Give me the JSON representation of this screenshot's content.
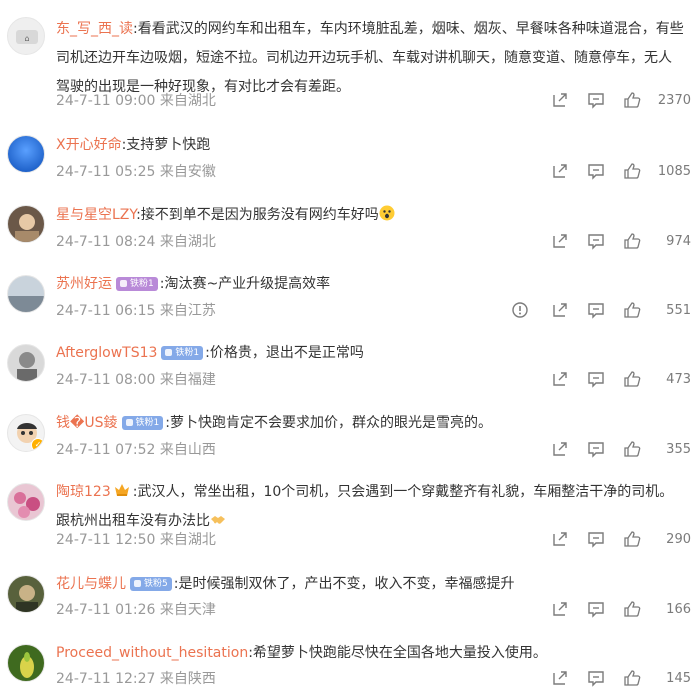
{
  "colors": {
    "username": "#eb7350",
    "meta": "#999999",
    "text": "#333333",
    "icon": "#7b7b7b"
  },
  "comments": [
    {
      "user": "东_写_西_读",
      "text": ":看看武汉的网约车和出租车，车内环境脏乱差，烟味、烟灰、早餐味各种味道混合，有些司机还边开车边吸烟，短途不拉。司机边开边玩手机、车载对讲机聊天，随意变道、随意停车，无人驾驶的出现是一种好现象，有对比才会有差距。",
      "time": "24-7-11 09:00",
      "location": "来自湖北",
      "likes": "2370"
    },
    {
      "user": "X开心好命",
      "text": ":支持萝卜快跑",
      "time": "24-7-11 05:25",
      "location": "来自安徽",
      "likes": "1085"
    },
    {
      "user": "星与星空LZY",
      "text": ":接不到单不是因为服务没有网约车好吗",
      "time": "24-7-11 08:24",
      "location": "来自湖北",
      "likes": "974"
    },
    {
      "user": "苏州好运",
      "badge": "铁粉1",
      "text": ":淘汰赛~产业升级提高效率",
      "time": "24-7-11 06:15",
      "location": "来自江苏",
      "likes": "551"
    },
    {
      "user": "AfterglowTS13",
      "badge": "铁粉1",
      "text": ":价格贵，退出不是正常吗",
      "time": "24-7-11 08:00",
      "location": "来自福建",
      "likes": "473"
    },
    {
      "user": "钱�US錂",
      "badge": "铁粉1",
      "text": ":萝卜快跑肯定不会要求加价，群众的眼光是雪亮的。",
      "time": "24-7-11 07:52",
      "location": "来自山西",
      "likes": "355"
    },
    {
      "user": "陶琼123",
      "text": ":武汉人，常坐出租，10个司机，只会遇到一个穿戴整齐有礼貌，车厢整洁干净的司机。跟杭州出租车没有办法比",
      "time": "24-7-11 12:50",
      "location": "来自湖北",
      "likes": "290"
    },
    {
      "user": "花儿与蝶儿",
      "badge": "铁粉5",
      "text": ":是时候强制双休了，产出不变，收入不变，幸福感提升",
      "time": "24-7-11 01:26",
      "location": "来自天津",
      "likes": "166"
    },
    {
      "user": "Proceed_without_hesitation",
      "text": ":希望萝卜快跑能尽快在全国各地大量投入使用。",
      "time": "24-7-11 12:27",
      "location": "来自陕西",
      "likes": "145"
    }
  ],
  "icons": {
    "share": "share-icon",
    "comment": "comment-icon",
    "like": "like-icon",
    "report": "report-icon"
  }
}
